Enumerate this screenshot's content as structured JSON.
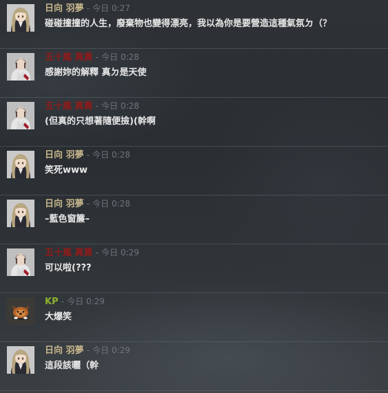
{
  "colors": {
    "hinata": "#c8b78e",
    "igarashi": "#8f1b1b",
    "kp": "#8db12d",
    "meta": "#6f757b",
    "text": "#e8e8e8"
  },
  "messages": [
    {
      "author": "日向 羽夢",
      "dash": "-",
      "time": "今日 0:27",
      "text": "碰碰撞撞的人生，廢棄物也變得漂亮，我以為你是要營造這種氣氛ㄉ（？",
      "avatar": "girl-avatar"
    },
    {
      "author": "五十嵐 真貴",
      "dash": "-",
      "time": "今日 0:28",
      "text": "感謝妳的解釋 真ㄉ是天使",
      "avatar": "boy-avatar"
    },
    {
      "author": "五十嵐 真貴",
      "dash": "-",
      "time": "今日 0:28",
      "text": "(但真的只想著隨便撿)(幹啊",
      "avatar": "boy-avatar"
    },
    {
      "author": "日向 羽夢",
      "dash": "-",
      "time": "今日 0:28",
      "text": "笑死www",
      "avatar": "girl-avatar"
    },
    {
      "author": "日向 羽夢",
      "dash": "-",
      "time": "今日 0:28",
      "text": "–藍色窗簾–",
      "avatar": "girl-avatar"
    },
    {
      "author": "五十嵐 真貴",
      "dash": "-",
      "time": "今日 0:29",
      "text": "可以啦(???",
      "avatar": "boy-avatar"
    },
    {
      "author": "KP",
      "dash": "-",
      "time": "今日 0:29",
      "text": "大爆笑",
      "avatar": "dog-avatar"
    },
    {
      "author": "日向 羽夢",
      "dash": "-",
      "time": "今日 0:29",
      "text": "這段該曬（幹",
      "avatar": "girl-avatar"
    }
  ]
}
